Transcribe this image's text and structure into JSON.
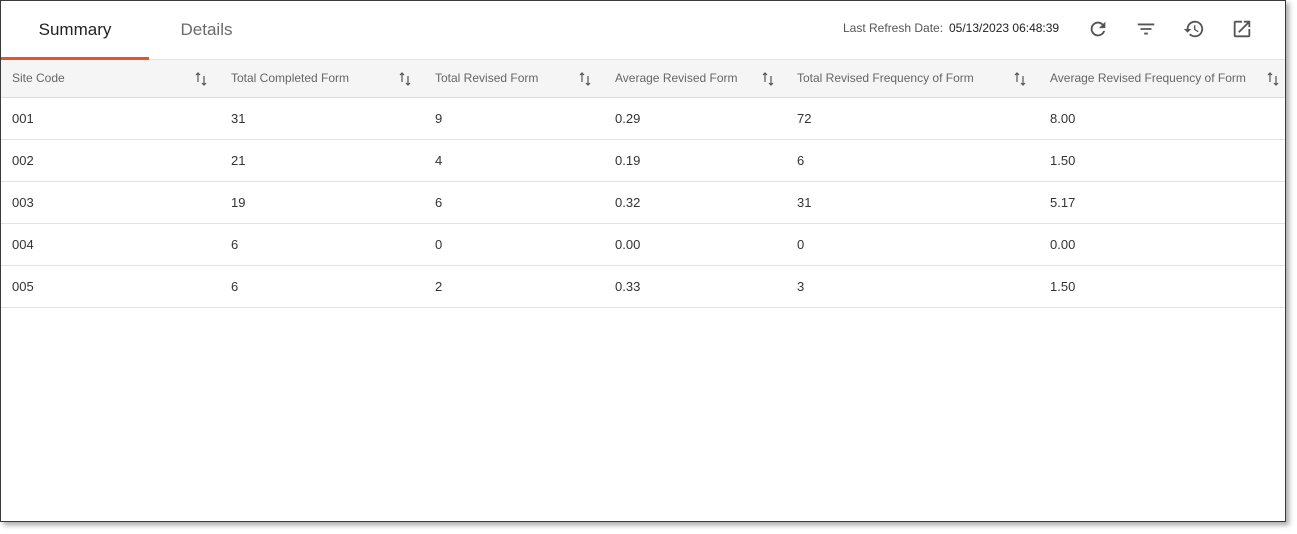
{
  "tabs": [
    {
      "label": "Summary",
      "active": true
    },
    {
      "label": "Details",
      "active": false
    }
  ],
  "refresh": {
    "label": "Last Refresh Date:",
    "value": "05/13/2023 06:48:39"
  },
  "toolbar": {
    "icons": [
      "refresh-icon",
      "filter-icon",
      "history-icon",
      "open-external-icon"
    ]
  },
  "colors": {
    "accent": "#e8542a",
    "header_bg": "#f5f5f5",
    "icon": "#555555"
  },
  "table": {
    "columns": [
      "Site Code",
      "Total Completed Form",
      "Total Revised Form",
      "Average Revised Form",
      "Total Revised Frequency of Form",
      "Average Revised Frequency of Form"
    ],
    "rows": [
      [
        "001",
        "31",
        "9",
        "0.29",
        "72",
        "8.00"
      ],
      [
        "002",
        "21",
        "4",
        "0.19",
        "6",
        "1.50"
      ],
      [
        "003",
        "19",
        "6",
        "0.32",
        "31",
        "5.17"
      ],
      [
        "004",
        "6",
        "0",
        "0.00",
        "0",
        "0.00"
      ],
      [
        "005",
        "6",
        "2",
        "0.33",
        "3",
        "1.50"
      ]
    ]
  }
}
